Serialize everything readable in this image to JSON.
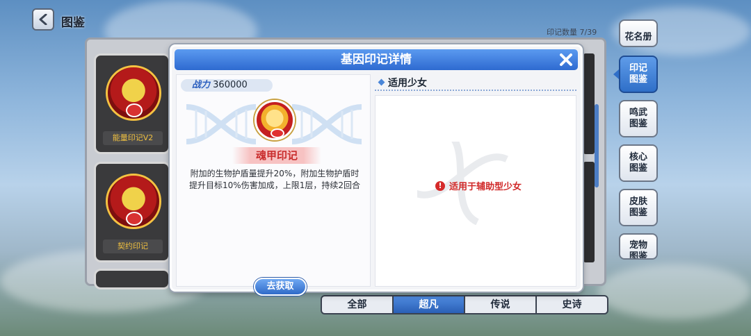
{
  "header": {
    "title": "图鉴",
    "count_label": "印记数量 7/39"
  },
  "album_cards": [
    {
      "name": "能量印记V2"
    },
    {
      "name": "契约印记"
    }
  ],
  "side_tabs": [
    {
      "label": "花名册",
      "active": false
    },
    {
      "label": "印记\n图鉴",
      "active": true
    },
    {
      "label": "鸣武\n图鉴",
      "active": false
    },
    {
      "label": "核心\n图鉴",
      "active": false
    },
    {
      "label": "皮肤\n图鉴",
      "active": false
    },
    {
      "label": "宠物\n图鉴",
      "active": false
    }
  ],
  "filter_tabs": [
    {
      "label": "全部",
      "active": false
    },
    {
      "label": "超凡",
      "active": true
    },
    {
      "label": "传说",
      "active": false
    },
    {
      "label": "史诗",
      "active": false
    }
  ],
  "modal": {
    "title": "基因印记详情",
    "power_label": "战力",
    "power_value": "360000",
    "mark_name": "魂甲印记",
    "mark_desc": "附加的生物护盾量提升20%，附加生物护盾时提升目标10%伤害加成，上限1层，持续2回合",
    "obtain_label": "去获取",
    "girls_title": "适用少女",
    "notice": "适用于辅助型少女"
  },
  "colors": {
    "accent_blue": "#2e6ad0",
    "mark_red": "#c92c2c"
  }
}
